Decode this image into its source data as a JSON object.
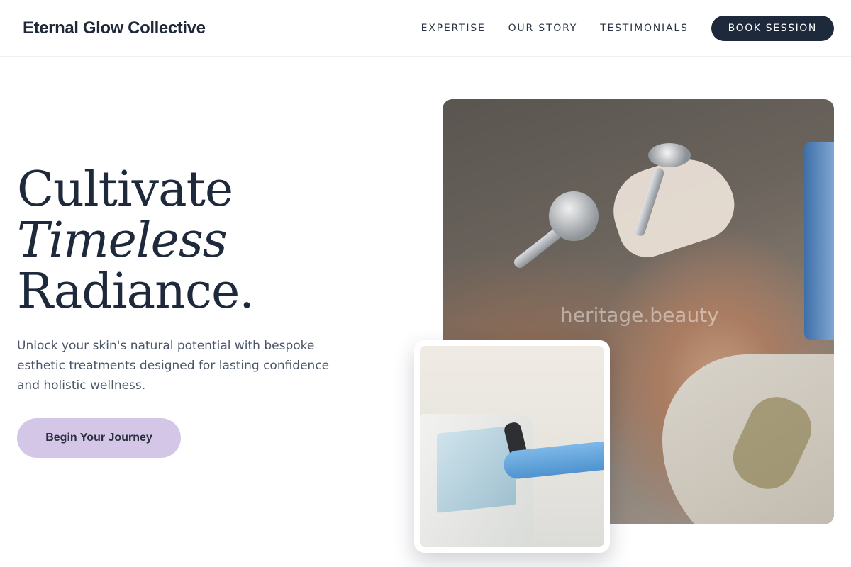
{
  "header": {
    "brand": "Eternal Glow Collective",
    "nav": [
      {
        "label": "EXPERTISE"
      },
      {
        "label": "OUR STORY"
      },
      {
        "label": "TESTIMONIALS"
      }
    ],
    "cta_label": "BOOK SESSION"
  },
  "hero": {
    "title_line1": "Cultivate",
    "title_line2": "Timeless",
    "title_line3": "Radiance.",
    "subtitle": "Unlock your skin's natural potential with bespoke esthetic treatments designed for lasting confidence and holistic wellness.",
    "cta_label": "Begin Your Journey"
  },
  "images": {
    "main_watermark": "heritage.beauty"
  },
  "colors": {
    "primary_dark": "#1e293b",
    "accent_lavender": "#d4c6e7",
    "text_muted": "#4a5567"
  }
}
